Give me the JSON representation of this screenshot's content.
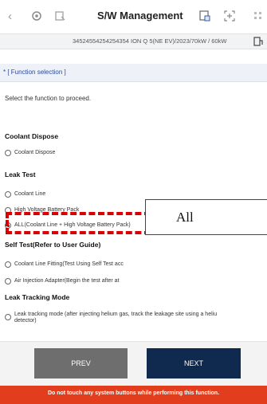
{
  "header": {
    "title": "S/W Management",
    "back_icon": "chevron-left-icon",
    "icons": [
      "settings-icon",
      "vehicle-connect-icon",
      "report-icon",
      "screenshot-icon",
      "grid-icon"
    ]
  },
  "vehicle_bar": {
    "vin_info": "34524554254254354 ION Q 5(NE EV)/2023/70kW / 60kW",
    "icon": "car-icon"
  },
  "section_header": "* [ Function selection ]",
  "instruction": "Select the function to proceed.",
  "groups": [
    {
      "title": "Coolant Dispose",
      "options": [
        {
          "label": "Coolant Dispose",
          "selected": false
        }
      ]
    },
    {
      "title": "Leak Test",
      "options": [
        {
          "label": "Coolant Line",
          "selected": false
        },
        {
          "label": "High Voltage Battery Pack",
          "selected": false
        },
        {
          "label": "ALL(Coolant Line + High Voltage Battery Pack)",
          "selected": true
        }
      ]
    },
    {
      "title": "Self Test(Refer to User Guide)",
      "options": [
        {
          "label": "Coolant Line Fitting(Test Using Self Test acc",
          "selected": false
        },
        {
          "label": "Air Injection Adapter(Begin the test after at",
          "selected": false
        }
      ]
    },
    {
      "title": "Leak Tracking Mode",
      "options": [
        {
          "label_line1": "Leak tracking mode (after injecting helium gas, track the leakage site using a heliu",
          "label_line2": "detector)",
          "selected": false
        }
      ]
    }
  ],
  "tooltip": "All",
  "buttons": {
    "prev": "PREV",
    "next": "NEXT"
  },
  "warning": "Do not touch any system buttons while performing this function.",
  "colors": {
    "warning_bg": "#e23d1c",
    "next_bg": "#0f2a4e",
    "prev_bg": "#6e6e6e",
    "highlight": "#d80000"
  }
}
